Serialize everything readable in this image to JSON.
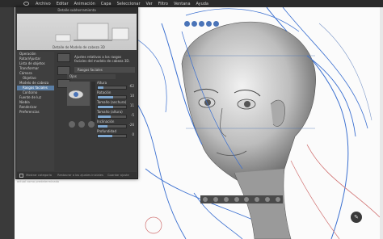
{
  "menubar": {
    "items": [
      "Archivo",
      "Editar",
      "Animación",
      "Capa",
      "Seleccionar",
      "Ver",
      "Filtro",
      "Ventana",
      "Ayuda"
    ]
  },
  "dialog": {
    "title": "Detalle subherramienta",
    "banner_title": "Detalle de Modelo de cabeza 3D",
    "description": "Ajustes relativos a los rasgos faciales del modelo de cabeza 3D.",
    "nav": [
      {
        "label": "Operación",
        "sub": false,
        "selected": false
      },
      {
        "label": "Rotar/Ajustar",
        "sub": false,
        "selected": false
      },
      {
        "label": "Lista de objetos",
        "sub": false,
        "selected": false
      },
      {
        "label": "Transformar",
        "sub": false,
        "selected": false
      },
      {
        "label": "Cámara",
        "sub": false,
        "selected": false
      },
      {
        "label": "Objetivo",
        "sub": true,
        "selected": false
      },
      {
        "label": "Modelo de cabeza",
        "sub": false,
        "selected": false
      },
      {
        "label": "Rasgos faciales",
        "sub": true,
        "selected": true
      },
      {
        "label": "Contorno",
        "sub": true,
        "selected": false
      },
      {
        "label": "Fuente de luz",
        "sub": false,
        "selected": false
      },
      {
        "label": "Niebla",
        "sub": false,
        "selected": false
      },
      {
        "label": "Renderizar",
        "sub": false,
        "selected": false
      },
      {
        "label": "Preferencias",
        "sub": false,
        "selected": false
      }
    ],
    "section": "Rasgos faciales",
    "subsection": "Ojos",
    "fields": [
      {
        "label": "Altura",
        "value": "-62",
        "frac": 0.2
      },
      {
        "label": "Rotación",
        "value": "10",
        "frac": 0.55
      },
      {
        "label": "Tamaño (anchura)",
        "value": "11",
        "frac": 0.55
      },
      {
        "label": "Tamaño (altura)",
        "value": "-5",
        "frac": 0.45
      },
      {
        "label": "Inclinación",
        "value": "-26",
        "frac": 0.35
      },
      {
        "label": "Profundidad",
        "value": "0",
        "frac": 0.5
      }
    ],
    "footer": [
      "Mostrar categoría",
      "Restaurar a los ajustes iniciales",
      "Guardar ajuste actual como predeterminado"
    ]
  },
  "colors": {
    "accent": "#5a7ea5",
    "stroke_blue": "#3a6fd0",
    "stroke_red": "#d07070"
  }
}
